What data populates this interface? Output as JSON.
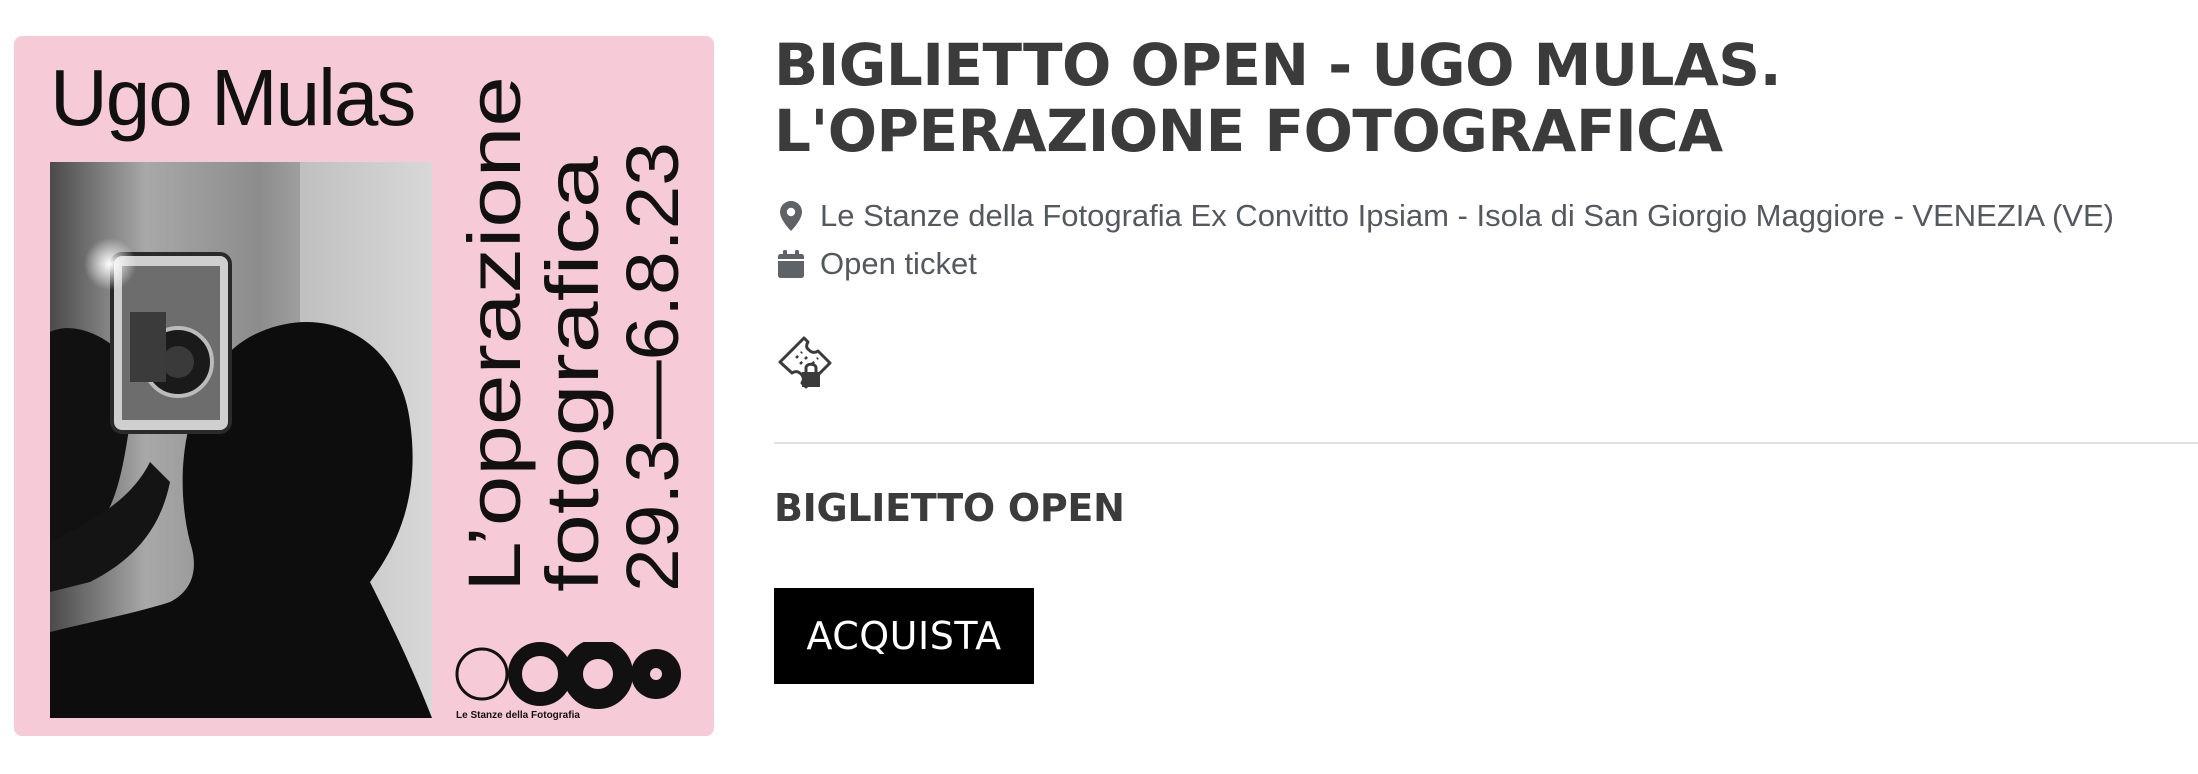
{
  "poster": {
    "artist": "Ugo Mulas",
    "vertical_line_1": "L’operazione",
    "vertical_line_2": "fotografica",
    "vertical_line_3": "29.3—6.8.23",
    "logo_caption": "Le Stanze della Fotografia",
    "background_color": "#f6cad6"
  },
  "event": {
    "title": "BIGLIETTO OPEN - UGO MULAS. L'OPERAZIONE FOTOGRAFICA",
    "location": "Le Stanze della Fotografia Ex Convitto Ipsiam - Isola di San Giorgio Maggiore - VENEZIA (VE)",
    "location_icon": "map-marker-icon",
    "date_text": "Open ticket",
    "date_icon": "calendar-icon",
    "ticket_icon": "ticket-icon"
  },
  "tickets": {
    "section_title": "BIGLIETTO OPEN",
    "buy_label": "ACQUISTA",
    "buy_button_color": "#000000"
  }
}
